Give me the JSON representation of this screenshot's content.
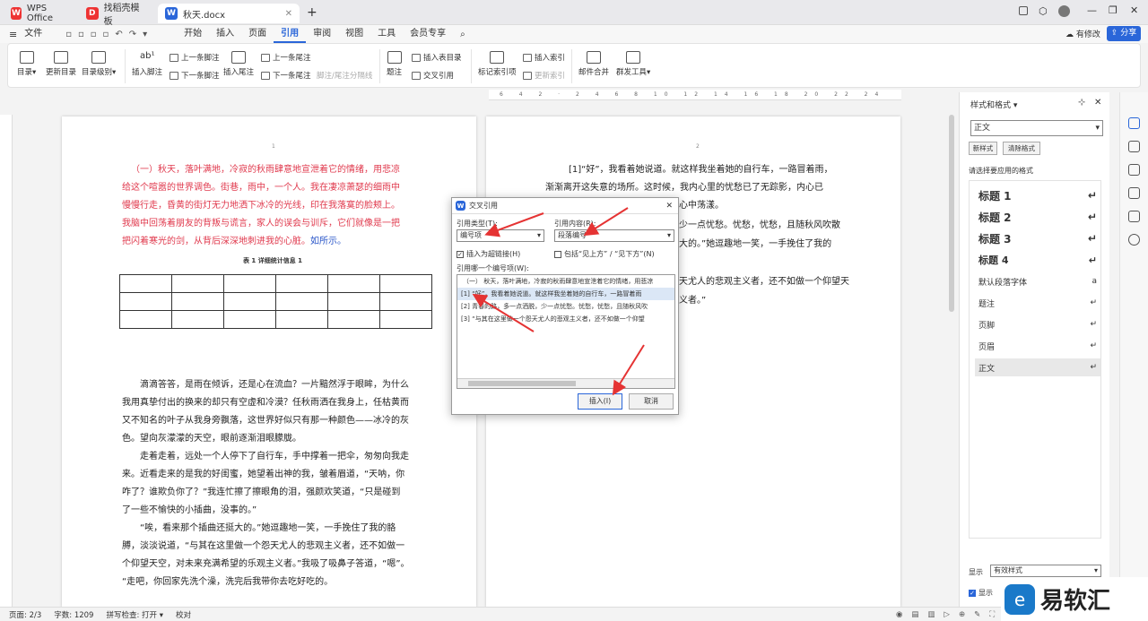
{
  "tabs": {
    "wps": "WPS Office",
    "template": "找稻壳模板",
    "doc": "秋天.docx"
  },
  "menu": {
    "file": "文件",
    "items": [
      "开始",
      "插入",
      "页面",
      "引用",
      "审阅",
      "视图",
      "工具",
      "会员专享"
    ],
    "active_index": 3,
    "has_changes": "有修改",
    "share": "分享"
  },
  "ribbon": {
    "toc": "目录",
    "update_toc": "更新目录",
    "toc_level": "目录级别",
    "insert_footnote": "插入脚注",
    "prev_footnote": "上一条脚注",
    "next_footnote": "下一条脚注",
    "insert_endnote": "插入尾注",
    "prev_endnote": "上一条尾注",
    "next_endnote": "下一条尾注",
    "footnote_sep": "脚注/尾注分隔线",
    "caption": "题注",
    "insert_table_of_figures": "插入表目录",
    "cross_ref": "交叉引用",
    "mark_index": "标记索引项",
    "insert_index": "插入索引",
    "update_index": "更新索引",
    "mail_merge": "邮件合并",
    "doc_tools": "群发工具"
  },
  "doc": {
    "page1_num": "1",
    "page2_num": "2",
    "red_para": "（一）秋天，落叶满地，冷寂的秋雨肆意地宣泄着它的情绪，用悲凉给这个喧嚣的世界调色。街巷，雨中，一个人。我在凄凉萧瑟的细雨中慢慢行走，昏黄的街灯无力地洒下冰冷的光线，印在我落寞的脸颊上。我脑中回荡着朋友的背叛与谎言，家人的误会与训斥，它们就像是一把把闪着寒光的剑，从背后深深地刺进我的心脏。",
    "red_lines": [
      "（一）秋天，落叶满地，冷寂的秋雨肆意地宣泄着它的情绪，用悲凉",
      "给这个喧嚣的世界调色。街巷，雨中，一个人。我在凄凉萧瑟的细雨中",
      "慢慢行走，昏黄的街灯无力地洒下冰冷的光线，印在我落寞的脸颊上。",
      "我脑中回荡着朋友的背叛与谎言，家人的误会与训斥，它们就像是一把",
      "把闪着寒光的剑，从背后深深地刺进我的心脏。"
    ],
    "as_shown": "如所示。",
    "table_caption": "表 1 详细统计信息 1",
    "para2_lines": [
      "滴滴答答，是雨在倾诉，还是心在流血？一片黯然浮于眼眸，为什么",
      "我用真挚付出的换来的却只有空虚和冷漠？任秋雨洒在我身上，任枯黄而",
      "又不知名的叶子从我身旁飘落，这世界好似只有那一种颜色——冰冷的灰",
      "色。望向灰濛濛的天空，眼前逐渐泪眼朦胧。"
    ],
    "para3_lines": [
      "走着走着，远处一个人停下了自行车，手中撑着一把伞，匆匆向我走",
      "来。近看走来的是我的好闺蜜，她望着出神的我，皱着眉道，“天呐，你",
      "咋了？谁欺负你了？”我连忙擦了擦眼角的泪，强颜欢笑道，“只是碰到",
      "了一些不愉快的小插曲，没事的。”"
    ],
    "para4_lines": [
      "“唉，看来那个插曲还挺大的。”她逗趣地一笑，一手挽住了我的胳",
      "膊，淡淡说道，“与其在这里做一个怨天尤人的悲观主义者，还不如做一",
      "个仰望天空，对未来充满希望的乐观主义者。”我吸了吸鼻子答道，“嗯”。",
      "“走吧，你回家先洗个澡，洗完后我带你去吃好吃的。"
    ],
    "p2_lines": [
      "[1]“好”，我看着她说道。就这样我坐着她的自行车，一路冒着雨，",
      "渐渐离开这失意的场所。这时候，我内心里的忧愁已了无踪影，内心已",
      "心中荡漾。",
      "少一点忧愁。忧愁，忧愁，且随秋风吹散",
      "大的。”她逗趣地一笑，一手挽住了我的",
      "天尤人的悲观主义者，还不如做一个仰望天",
      "义者。”"
    ]
  },
  "dialog": {
    "title": "交叉引用",
    "ref_type_label": "引用类型(T):",
    "ref_type_value": "编号项",
    "ref_content_label": "引用内容(R):",
    "ref_content_value": "段落编号",
    "hyperlink_label": "插入为超链接(H)",
    "above_below_label": "包括“见上方” / “见下方”(N)",
    "which_label": "引用哪一个编号项(W):",
    "items": [
      "（一） 秋天，落叶满地，冷寂的秋雨肆意地宣泄着它的情绪，用悲凉",
      "[1] “好”，我看着她说道。就这样我坐着她的自行车，一路冒着雨",
      "[2] 青春的路，多一点洒脱，少一点忧愁。忧愁，忧愁，且随秋风吹",
      "[3] “与其在这里做一个怨天尤人的悲观主义者，还不如做一个仰望"
    ],
    "selected_index": 1,
    "insert": "插入(I)",
    "cancel": "取消"
  },
  "side": {
    "title": "样式和格式",
    "current": "正文",
    "new_style": "新样式",
    "clear_format": "清除格式",
    "apply_label": "请选择要应用的格式",
    "styles": [
      "标题 1",
      "标题 2",
      "标题 3",
      "标题 4",
      "默认段落字体",
      "题注",
      "页脚",
      "页眉",
      "正文"
    ],
    "show_label": "显示",
    "show_value": "有效样式",
    "preview_label": "显示"
  },
  "status": {
    "page": "页面: 2/3",
    "words": "字数: 1209",
    "spell": "拼写检查: 打开",
    "proof": "校对",
    "zoom": "85"
  },
  "watermark": "易软汇",
  "colors": {
    "accent": "#2a66d9",
    "red_text": "#e0394d",
    "arrow": "#e53333"
  }
}
